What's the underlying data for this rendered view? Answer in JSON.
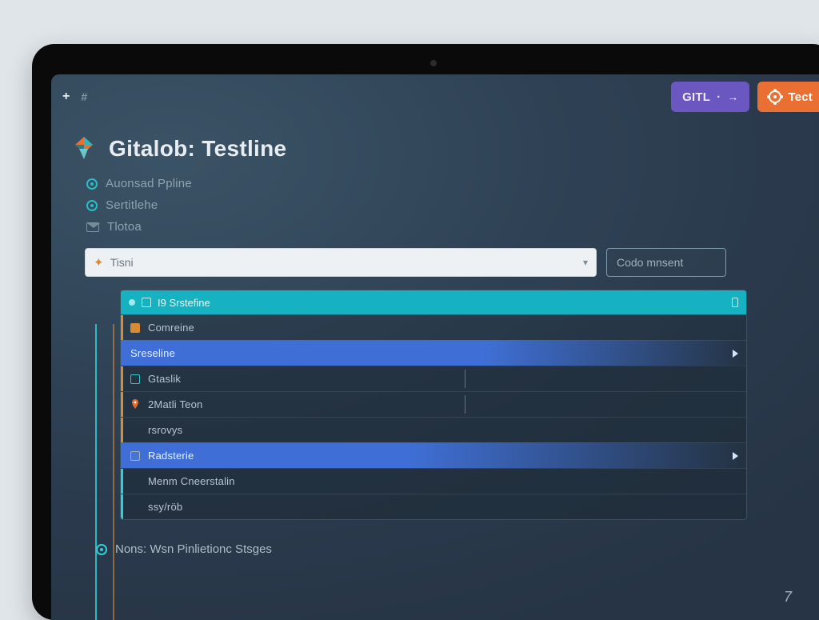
{
  "topbar": {
    "plus": "+",
    "hash": "#",
    "gitl_button": "GITL",
    "gitl_arrow": "→",
    "test_button": "Tect"
  },
  "title": "Gitalob: Testline",
  "nav": {
    "items": [
      {
        "label": "Auonsad Ppline"
      },
      {
        "label": "Sertitlehe"
      },
      {
        "label": "Tlotoa"
      }
    ]
  },
  "search": {
    "value": "Tisni",
    "spark": "✦"
  },
  "comment": {
    "placeholder": "Codo mnsent"
  },
  "panel": {
    "header": "I9 Srstefine",
    "rows": [
      {
        "kind": "comreine",
        "label": "Comreine",
        "marker": "orange"
      },
      {
        "kind": "selected",
        "label": "Sreseline",
        "marker": "none"
      },
      {
        "kind": "sub",
        "label": "Gtaslik",
        "marker": "teal"
      },
      {
        "kind": "sub",
        "label": "2Matli Teon",
        "marker": "pin"
      },
      {
        "kind": "sub",
        "label": "rsrovys",
        "marker": "none"
      },
      {
        "kind": "radsterie",
        "label": "Radsterie",
        "marker": "fold"
      },
      {
        "kind": "sub",
        "label": "Menm Cneerstalin",
        "marker": "none"
      },
      {
        "kind": "sub",
        "label": "ssy/röb",
        "marker": "none"
      }
    ]
  },
  "footer": {
    "label": "Nons: Wsn Pinlietionc Stsges"
  },
  "footer_arrow": "7"
}
